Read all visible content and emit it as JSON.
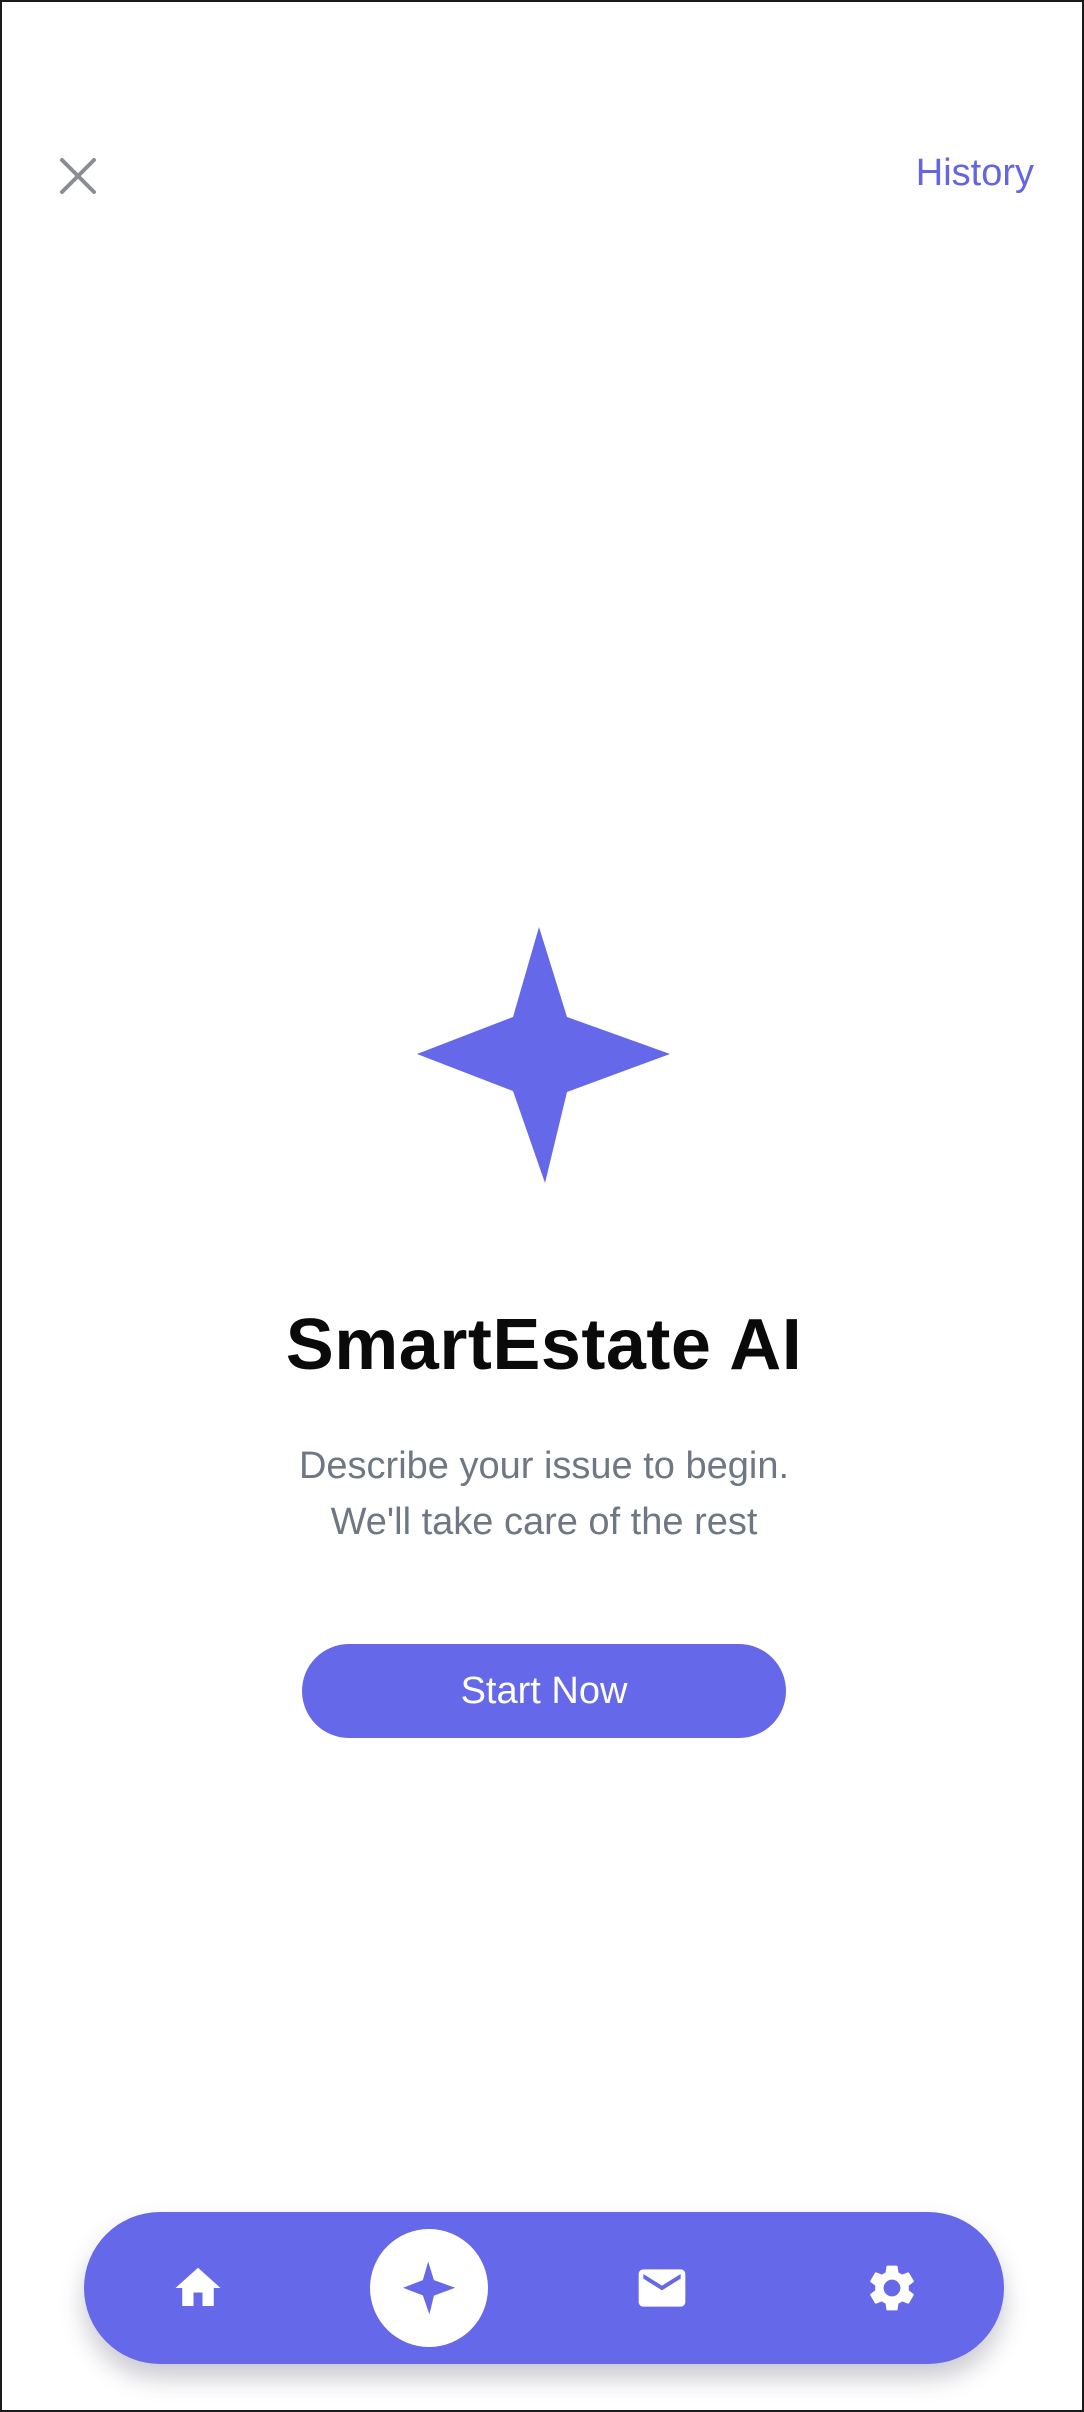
{
  "header": {
    "close_icon": "close-icon",
    "history_label": "History"
  },
  "hero": {
    "icon": "sparkle-star-icon",
    "title": "SmartEstate AI",
    "subtitle_line1": "Describe your issue to begin.",
    "subtitle_line2": "We'll take care of the rest",
    "cta_label": "Start Now"
  },
  "bottom_nav": {
    "items": [
      {
        "icon": "home-icon",
        "active": false
      },
      {
        "icon": "sparkle-star-icon",
        "active": true
      },
      {
        "icon": "mail-icon",
        "active": false
      },
      {
        "icon": "gear-icon",
        "active": false
      }
    ]
  },
  "colors": {
    "accent": "#6568e8",
    "link": "#6366e0",
    "title": "#0a0a0a",
    "subtitle": "#707784",
    "close_icon": "#8a8d96",
    "background": "#ffffff"
  }
}
